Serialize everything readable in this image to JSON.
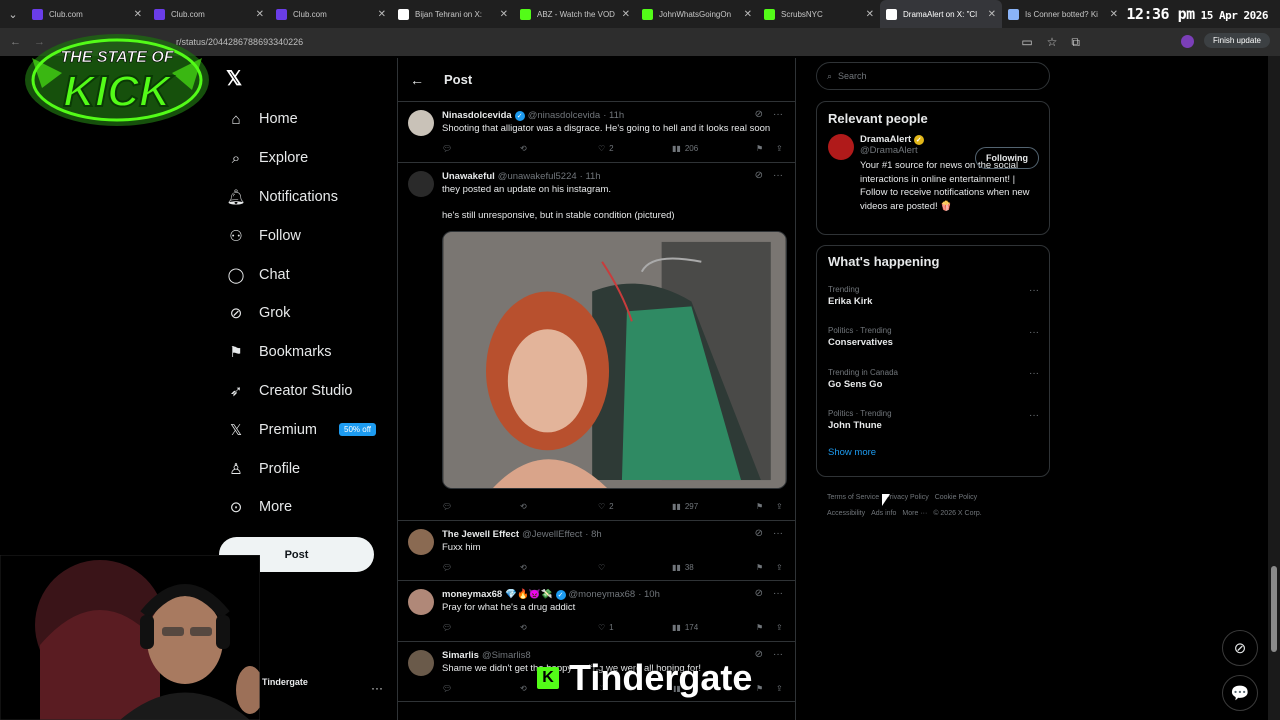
{
  "browser": {
    "tabs": [
      {
        "label": "Club.com",
        "color": "#6a3de8"
      },
      {
        "label": "Club.com",
        "color": "#6a3de8"
      },
      {
        "label": "Club.com",
        "color": "#6a3de8"
      },
      {
        "label": "Bijan Tehrani on X:",
        "color": "#ffffff"
      },
      {
        "label": "ABZ - Watch the VOD",
        "color": "#53fc18"
      },
      {
        "label": "JohnWhatsGoingOn",
        "color": "#53fc18"
      },
      {
        "label": "ScrubsNYC",
        "color": "#53fc18"
      },
      {
        "label": "DramaAlert on X: \"Cl",
        "color": "#ffffff"
      },
      {
        "label": "Is Conner botted? Ki",
        "color": "#8ab4f8"
      }
    ],
    "url": "r/status/2044286788693340226",
    "finish_update": "Finish update",
    "clock_time": "12:36 pm",
    "clock_date": "15 Apr 2026"
  },
  "stream": {
    "logo_line1": "THE STATE OF",
    "logo_line2": "KICK",
    "account_name": "Tindergate",
    "overlay_title": "Tindergate",
    "overlay_k": "K"
  },
  "nav": {
    "items": [
      {
        "label": "Home",
        "icon": "home-icon"
      },
      {
        "label": "Explore",
        "icon": "search-icon"
      },
      {
        "label": "Notifications",
        "icon": "bell-icon"
      },
      {
        "label": "Follow",
        "icon": "person-plus-icon"
      },
      {
        "label": "Chat",
        "icon": "chat-icon"
      },
      {
        "label": "Grok",
        "icon": "grok-icon"
      },
      {
        "label": "Bookmarks",
        "icon": "bookmark-icon"
      },
      {
        "label": "Creator Studio",
        "icon": "rocket-icon"
      },
      {
        "label": "Premium",
        "icon": "x-logo-icon"
      },
      {
        "label": "Profile",
        "icon": "person-icon"
      },
      {
        "label": "More",
        "icon": "more-circle-icon"
      }
    ],
    "premium_badge": "50% off",
    "post_button": "Post"
  },
  "main": {
    "title": "Post",
    "replies": [
      {
        "name": "Ninasdolcevida",
        "verified": true,
        "handle": "@ninasdolcevida",
        "time": "· 11h",
        "text": [
          "Shooting that alligator was a disgrace. He's going to hell and it looks real soon"
        ],
        "replies": "",
        "reposts": "",
        "likes": "2",
        "views": "206",
        "avatar_color": "#c9c2b8"
      },
      {
        "name": "Unawakeful",
        "verified": false,
        "handle": "@unawakeful5224",
        "time": "· 11h",
        "text": [
          "they posted an update on his instagram.",
          "",
          "he's still unresponsive, but in stable condition (pictured)"
        ],
        "replies": "",
        "reposts": "",
        "likes": "2",
        "views": "297",
        "avatar_color": "#2a2a2a",
        "has_media": true
      },
      {
        "name": "The Jewell Effect",
        "verified": false,
        "handle": "@JewellEffect",
        "time": "· 8h",
        "text": [
          "Fuxx him"
        ],
        "replies": "",
        "reposts": "",
        "likes": "",
        "views": "38",
        "avatar_color": "#8a6a52"
      },
      {
        "name": "moneymax68",
        "verified": true,
        "handle": "@moneymax68",
        "time": "· 10h",
        "emoji": "💎🔥👿💸",
        "text": [
          "Pray for what he's a drug addict"
        ],
        "replies": "",
        "reposts": "",
        "likes": "1",
        "views": "174",
        "avatar_color": "#b08878"
      },
      {
        "name": "Simarlis",
        "verified": false,
        "handle": "@Simarlis8",
        "time": "",
        "text": [
          "Shame we didn't get the happy ending we were all hoping for!"
        ],
        "replies": "",
        "reposts": "",
        "likes": "",
        "views": "",
        "avatar_color": "#6a5a4a"
      }
    ]
  },
  "right": {
    "search_placeholder": "Search",
    "relevant_title": "Relevant people",
    "person": {
      "name": "DramaAlert",
      "handle": "@DramaAlert",
      "bio": "Your #1 source for news on the social interactions in online entertainment! | Follow to receive notifications when new videos are posted! 🍿",
      "follow_label": "Following"
    },
    "happening_title": "What's happening",
    "trends": [
      {
        "context": "Trending",
        "topic": "Erika Kirk"
      },
      {
        "context": "Politics · Trending",
        "topic": "Conservatives"
      },
      {
        "context": "Trending in Canada",
        "topic": "Go Sens Go"
      },
      {
        "context": "Politics · Trending",
        "topic": "John Thune"
      }
    ],
    "show_more": "Show more",
    "footer": [
      "Terms of Service",
      "Privacy Policy",
      "Cookie Policy",
      "Accessibility",
      "Ads info",
      "More ···",
      "© 2026 X Corp."
    ]
  }
}
